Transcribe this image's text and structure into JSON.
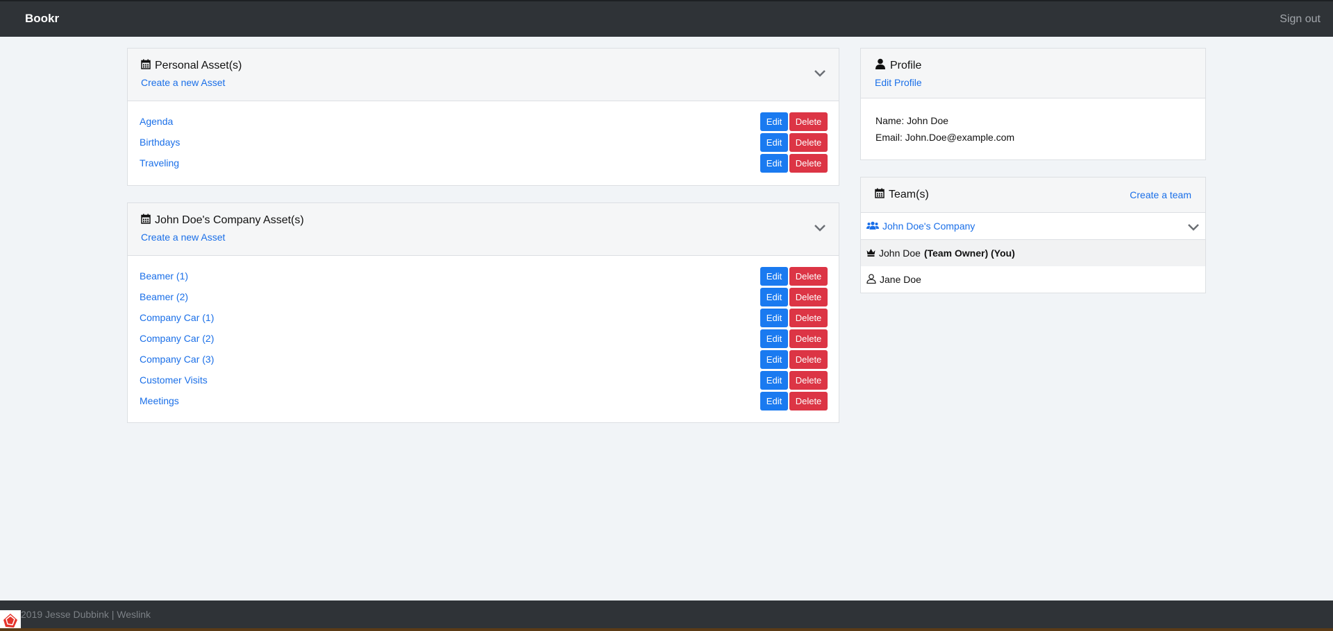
{
  "navbar": {
    "brand": "Bookr",
    "signout": "Sign out"
  },
  "personal": {
    "title": "Personal Asset(s)",
    "create_link": "Create a new Asset",
    "assets": [
      "Agenda",
      "Birthdays",
      "Traveling"
    ]
  },
  "company": {
    "title": "John Doe's Company Asset(s)",
    "create_link": "Create a new Asset",
    "assets": [
      "Beamer (1)",
      "Beamer (2)",
      "Company Car (1)",
      "Company Car (2)",
      "Company Car (3)",
      "Customer Visits",
      "Meetings"
    ]
  },
  "buttons": {
    "edit": "Edit",
    "delete": "Delete"
  },
  "profile": {
    "title": "Profile",
    "edit_link": "Edit Profile",
    "name_line": "Name: John Doe",
    "email_line": "Email: John.Doe@example.com"
  },
  "teams": {
    "title": "Team(s)",
    "create_link": "Create a team",
    "team_name": "John Doe's Company",
    "owner_name": "John Doe",
    "owner_tag": "(Team Owner) (You)",
    "member_name": "Jane Doe"
  },
  "footer": {
    "text": "2019 Jesse Dubbink | Weslink"
  },
  "colors": {
    "navbar": "#2f3337",
    "link": "#1a6fe8",
    "edit": "#1a7af0",
    "delete": "#dc3545",
    "background": "#f1f4f7"
  },
  "icons": {
    "section": "calendar-icon",
    "profile": "user-icon",
    "team": "users-icon",
    "owner": "crown-icon",
    "member": "user-outline-icon",
    "collapse": "chevron-down-icon"
  }
}
